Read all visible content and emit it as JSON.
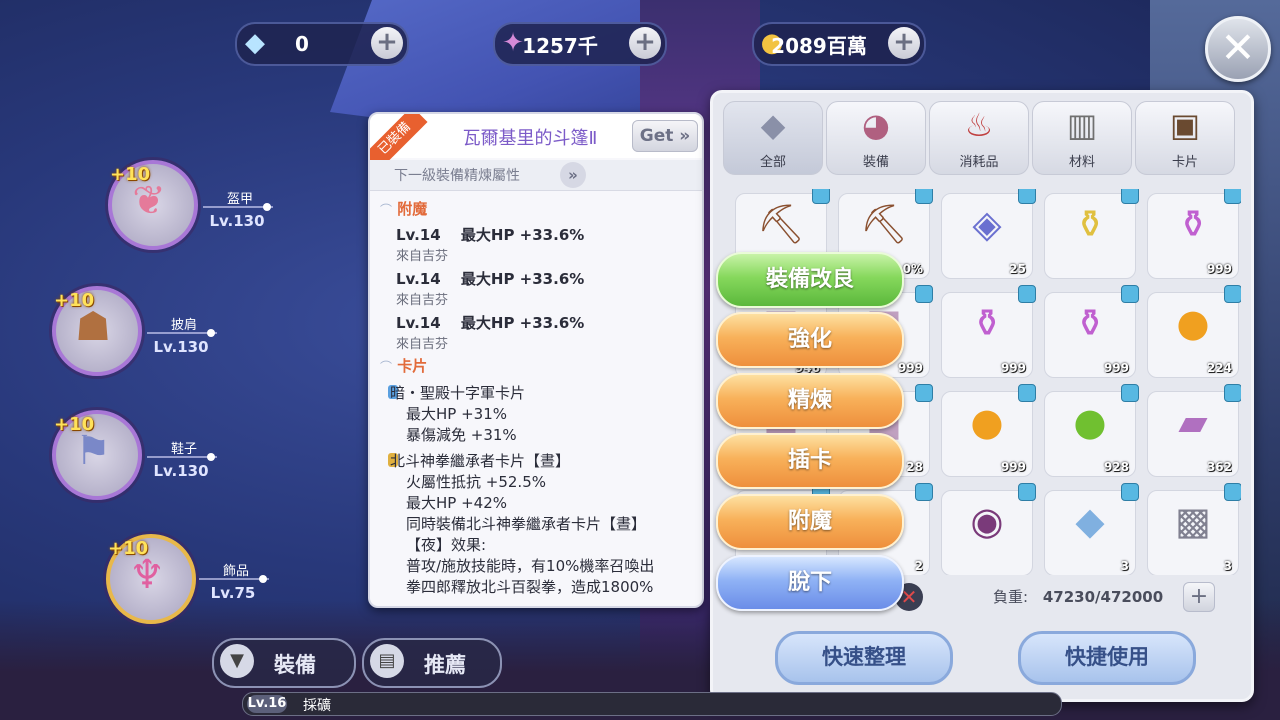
{
  "currencies": [
    {
      "icon": "diamond-icon",
      "value": "0"
    },
    {
      "icon": "crystal-icon",
      "value": "1257千"
    },
    {
      "icon": "coin-icon",
      "value": "2089百萬"
    }
  ],
  "slots": [
    {
      "name": "盔甲",
      "level": "Lv.130",
      "plus": "+10",
      "icon": "armor-icon"
    },
    {
      "name": "披肩",
      "level": "Lv.130",
      "plus": "+10",
      "icon": "cape-icon"
    },
    {
      "name": "鞋子",
      "level": "Lv.130",
      "plus": "+10",
      "icon": "boots-icon"
    },
    {
      "name": "飾品",
      "level": "Lv.75",
      "plus": "+10",
      "icon": "accessory-icon"
    }
  ],
  "detail": {
    "ribbon": "已裝備",
    "title": "瓦爾基里的斗篷Ⅱ",
    "get_label": "Get »",
    "sub_label": "下一級裝備精煉屬性",
    "sub_btn": "»",
    "enchant_header": "附魔",
    "enchants": [
      {
        "main": "Lv.14　 最大HP +33.6%",
        "src": "來自吉芬"
      },
      {
        "main": "Lv.14　 最大HP +33.6%",
        "src": "來自吉芬"
      },
      {
        "main": "Lv.14　 最大HP +33.6%",
        "src": "來自吉芬"
      }
    ],
    "card_header": "卡片",
    "cards": [
      {
        "name": "暗・聖殿十字軍卡片",
        "color": "#5aa0e0",
        "lines": [
          "最大HP +31%",
          "暴傷減免 +31%"
        ]
      },
      {
        "name": "北斗神拳繼承者卡片【晝】",
        "color": "#e0b040",
        "lines": [
          "火屬性抵抗 +52.5%",
          "最大HP +42%",
          "同時裝備北斗神拳繼承者卡片【晝】",
          "【夜】效果:",
          "普攻/施放技能時，有10%機率召喚出",
          "拳四郎釋放北斗百裂拳，造成1800%"
        ]
      }
    ]
  },
  "inventory": {
    "tabs": [
      {
        "label": "全部",
        "icon": "all-icon"
      },
      {
        "label": "裝備",
        "icon": "equipment-icon"
      },
      {
        "label": "消耗品",
        "icon": "consumable-icon"
      },
      {
        "label": "材料",
        "icon": "material-icon"
      },
      {
        "label": "卡片",
        "icon": "card-icon"
      }
    ],
    "rows": [
      [
        {
          "icon": "pickaxe-icon",
          "count": ""
        },
        {
          "icon": "pickaxe-icon",
          "count": "0%"
        },
        {
          "icon": "ore-icon",
          "count": "25"
        },
        {
          "icon": "yellow-potion-icon",
          "count": ""
        },
        {
          "icon": "purple-potion-icon",
          "count": "999"
        }
      ],
      [
        {
          "icon": "item-icon",
          "count": "946"
        },
        {
          "icon": "item-icon",
          "count": "999"
        },
        {
          "icon": "purple-potion-icon",
          "count": "999"
        },
        {
          "icon": "purple-potion-icon",
          "count": "999"
        },
        {
          "icon": "orange-orb-icon",
          "count": "224"
        }
      ],
      [
        {
          "icon": "item-icon",
          "count": ""
        },
        {
          "icon": "item-icon",
          "count": "28"
        },
        {
          "icon": "orange-orb-icon",
          "count": "999"
        },
        {
          "icon": "green-orb-icon",
          "count": "928"
        },
        {
          "icon": "cloth-icon",
          "count": "362"
        }
      ],
      [
        {
          "icon": "item-icon",
          "count": ""
        },
        {
          "icon": "item-icon",
          "count": "2"
        },
        {
          "icon": "gem-icon",
          "count": ""
        },
        {
          "icon": "crystal-shard-icon",
          "count": "3"
        },
        {
          "icon": "stone-tablet-icon",
          "count": "3"
        }
      ]
    ],
    "weight_label": "負重:",
    "weight_value": "47230/472000",
    "sort_label": "快速整理",
    "quick_use_label": "快捷使用"
  },
  "actions": [
    "裝備改良",
    "強化",
    "精煉",
    "插卡",
    "附魔",
    "脫下"
  ],
  "bottom": {
    "equip_tab": "裝備",
    "recommend_tab": "推薦",
    "level": "Lv.16",
    "job": "採礦"
  }
}
